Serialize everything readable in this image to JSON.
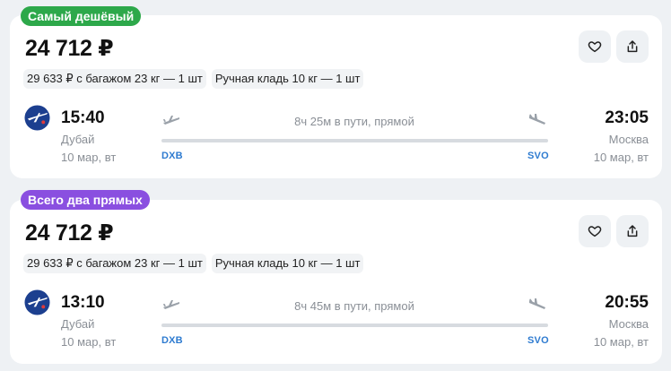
{
  "offers": [
    {
      "badge": "Самый дешёвый",
      "badge_color": "#2da84a",
      "price": "24 712 ₽",
      "baggage_chip": "29 633 ₽ с багажом 23 кг — 1 шт",
      "hand_luggage_chip": "Ручная кладь 10 кг — 1 шт",
      "departure": {
        "time": "15:40",
        "city": "Дубай",
        "date": "10 мар, вт",
        "code": "DXB"
      },
      "arrival": {
        "time": "23:05",
        "city": "Москва",
        "date": "10 мар, вт",
        "code": "SVO"
      },
      "duration": "8ч 25м в пути, прямой",
      "airline_logo": "aeroflot-logo"
    },
    {
      "badge": "Всего два прямых",
      "badge_color": "#8a4fe0",
      "price": "24 712 ₽",
      "baggage_chip": "29 633 ₽ с багажом 23 кг — 1 шт",
      "hand_luggage_chip": "Ручная кладь 10 кг — 1 шт",
      "departure": {
        "time": "13:10",
        "city": "Дубай",
        "date": "10 мар, вт",
        "code": "DXB"
      },
      "arrival": {
        "time": "20:55",
        "city": "Москва",
        "date": "10 мар, вт",
        "code": "SVO"
      },
      "duration": "8ч 45м в пути, прямой",
      "airline_logo": "aeroflot-logo"
    }
  ],
  "icons": {
    "favorite": "heart-icon",
    "share": "share-icon",
    "takeoff": "plane-takeoff-icon",
    "landing": "plane-landing-icon"
  },
  "colors": {
    "background": "#eef1f4",
    "airport_code": "#2e7bd0",
    "secondary_text": "#8a8f96"
  }
}
